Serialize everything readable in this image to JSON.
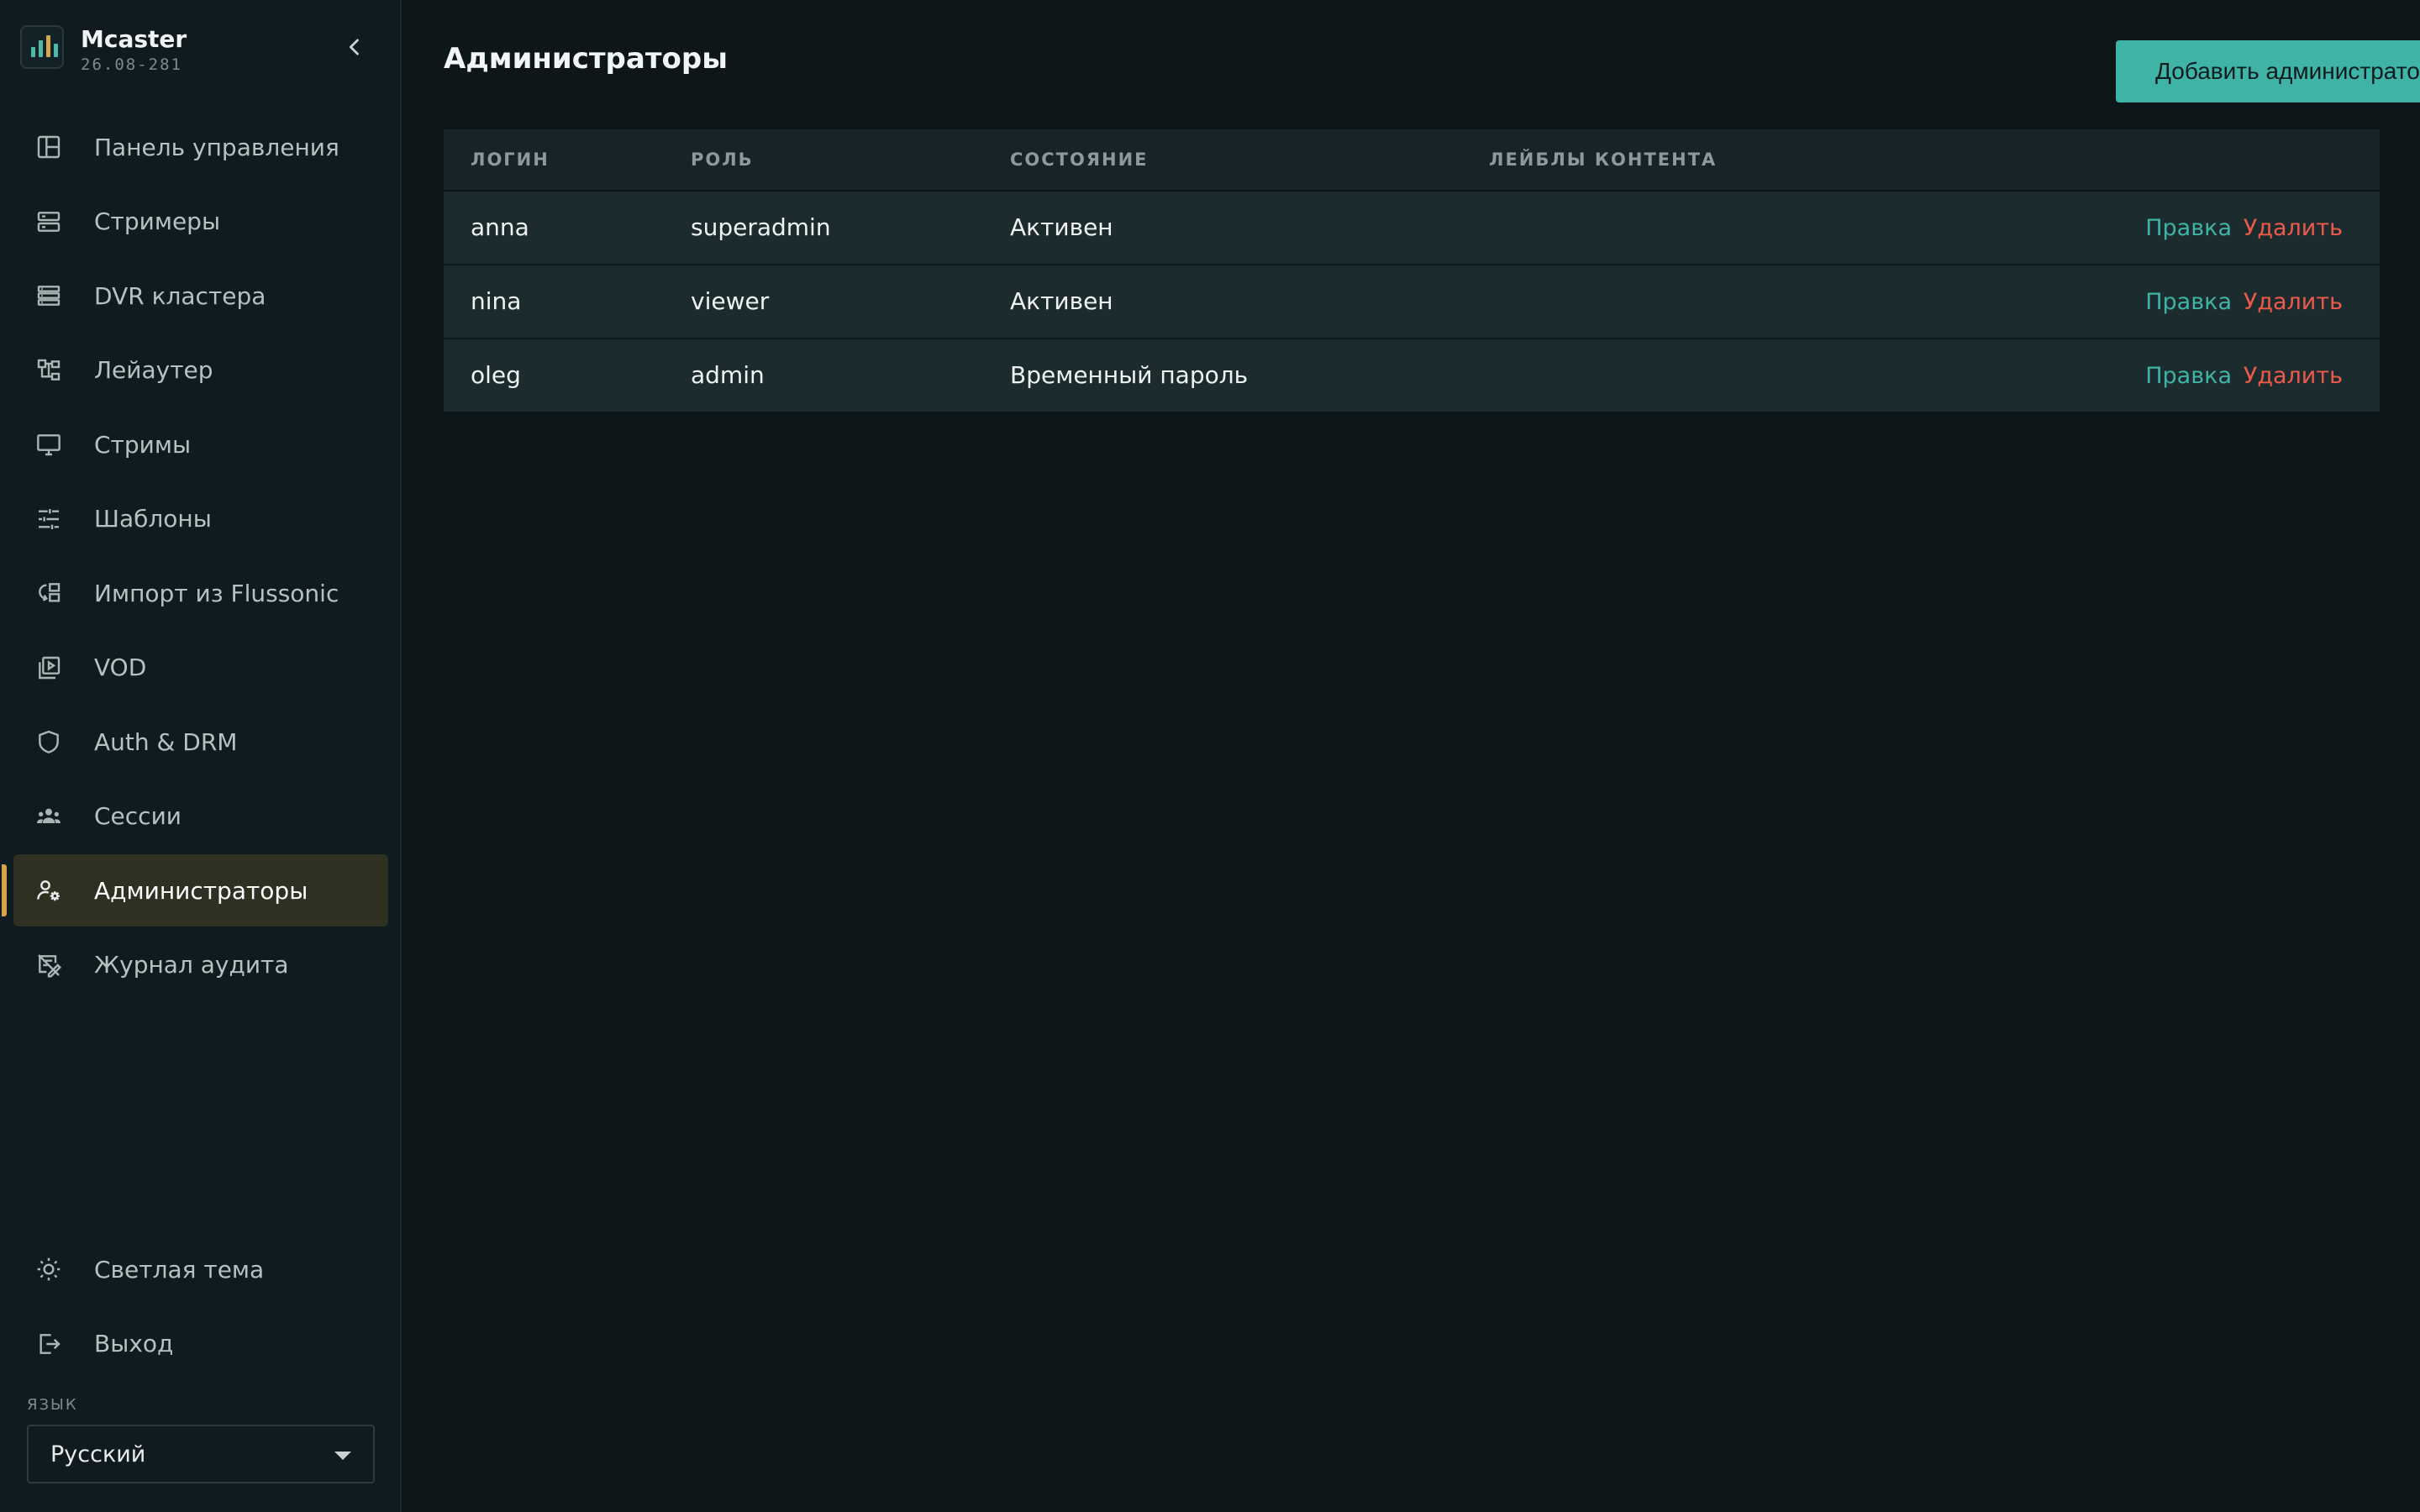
{
  "brand": {
    "name": "Mcaster",
    "version": "26.08-281"
  },
  "sidebar": {
    "items": [
      {
        "label": "Панель управления",
        "icon": "dashboard-icon"
      },
      {
        "label": "Стримеры",
        "icon": "server-icon"
      },
      {
        "label": "DVR кластера",
        "icon": "storage-icon"
      },
      {
        "label": "Лейаутер",
        "icon": "layout-tree-icon"
      },
      {
        "label": "Стримы",
        "icon": "monitor-icon"
      },
      {
        "label": "Шаблоны",
        "icon": "sliders-icon"
      },
      {
        "label": "Импорт из Flussonic",
        "icon": "import-icon"
      },
      {
        "label": "VOD",
        "icon": "video-library-icon"
      },
      {
        "label": "Auth & DRM",
        "icon": "shield-icon"
      },
      {
        "label": "Сессии",
        "icon": "users-group-icon"
      },
      {
        "label": "Администраторы",
        "icon": "user-gear-icon",
        "active": true
      },
      {
        "label": "Журнал аудита",
        "icon": "audit-log-icon"
      }
    ],
    "bottom": [
      {
        "label": "Светлая тема",
        "icon": "sun-icon"
      },
      {
        "label": "Выход",
        "icon": "logout-icon"
      }
    ],
    "language": {
      "label": "ЯЗЫК",
      "value": "Русский"
    }
  },
  "main": {
    "title": "Администраторы",
    "add_button": "Добавить администратора",
    "columns": [
      "ЛОГИН",
      "РОЛЬ",
      "СОСТОЯНИЕ",
      "ЛЕЙБЛЫ КОНТЕНТА"
    ],
    "rows": [
      {
        "login": "anna",
        "role": "superadmin",
        "state": "Активен",
        "labels": "",
        "edit": "Правка",
        "delete": "Удалить"
      },
      {
        "login": "nina",
        "role": "viewer",
        "state": "Активен",
        "labels": "",
        "edit": "Правка",
        "delete": "Удалить"
      },
      {
        "login": "oleg",
        "role": "admin",
        "state": "Временный пароль",
        "labels": "",
        "edit": "Правка",
        "delete": "Удалить"
      }
    ]
  },
  "colors": {
    "accent": "#3fb3a6",
    "danger": "#ee5a4a",
    "active_marker": "#d4a54d",
    "background": "#0d1719"
  }
}
